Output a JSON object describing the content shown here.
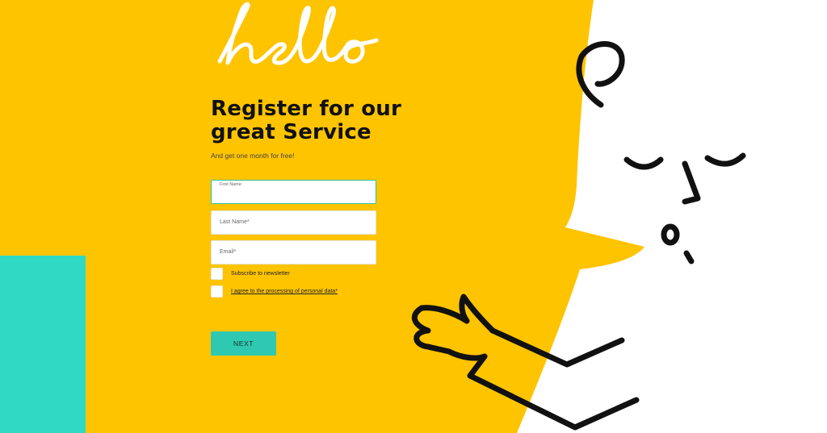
{
  "logo": {
    "text": "hello"
  },
  "heading": {
    "title": "Register for our great Service",
    "subtitle": "And get one month for free!"
  },
  "form": {
    "first_name": {
      "label": "First Name",
      "value": ""
    },
    "last_name": {
      "label": "Last Name*",
      "value": ""
    },
    "email": {
      "label": "Email*",
      "value": ""
    },
    "newsletter": {
      "label": "Subscribe to newsletter",
      "checked": false
    },
    "privacy": {
      "label": "I agree to the processing of personal data*",
      "checked": false
    },
    "next_label": "NEXT"
  },
  "colors": {
    "yellow": "#fec400",
    "teal_block": "#2fd9c4",
    "button": "#2fc9b2",
    "focus_border": "#2bc3a8",
    "text": "#111111"
  },
  "illustration": {
    "name": "character-illustration"
  }
}
